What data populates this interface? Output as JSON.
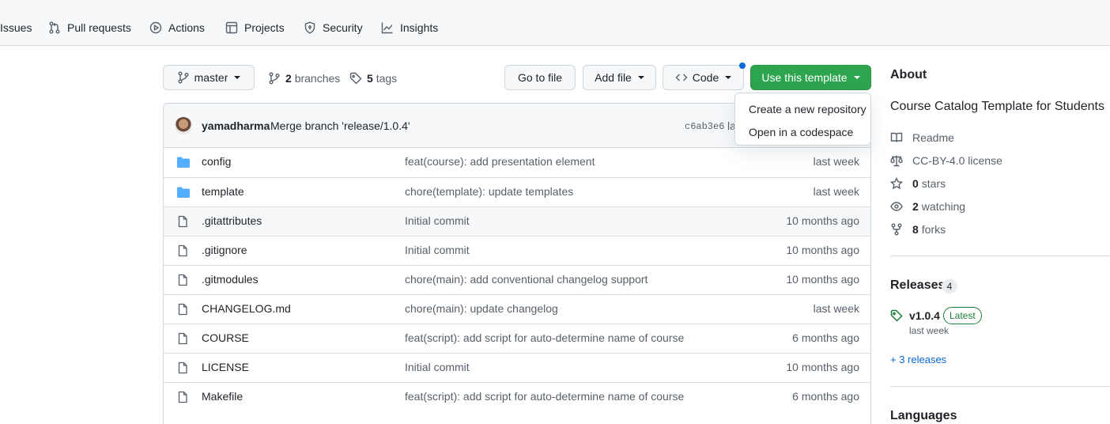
{
  "repo_nav": {
    "items": [
      {
        "label": "Issues",
        "icon": "issue-icon"
      },
      {
        "label": "Pull requests",
        "icon": "pull-request-icon"
      },
      {
        "label": "Actions",
        "icon": "play-icon"
      },
      {
        "label": "Projects",
        "icon": "table-icon"
      },
      {
        "label": "Security",
        "icon": "shield-icon"
      },
      {
        "label": "Insights",
        "icon": "graph-icon"
      }
    ]
  },
  "toolbar": {
    "branch": "master",
    "branches_count": "2",
    "branches_label": "branches",
    "tags_count": "5",
    "tags_label": "tags",
    "go_to_file": "Go to file",
    "add_file": "Add file",
    "code": "Code",
    "use_template": "Use this template"
  },
  "template_menu": {
    "items": [
      "Create a new repository",
      "Open in a codespace"
    ]
  },
  "latest_commit": {
    "author": "yamadharma",
    "message": "Merge branch 'release/1.0.4'",
    "sha": "c6ab3e6",
    "time_partial": "la"
  },
  "files": [
    {
      "type": "dir",
      "name": "config",
      "message": "feat(course): add presentation element",
      "time": "last week"
    },
    {
      "type": "dir",
      "name": "template",
      "message": "chore(template): update templates",
      "time": "last week"
    },
    {
      "type": "file",
      "name": ".gitattributes",
      "message": "Initial commit",
      "time": "10 months ago"
    },
    {
      "type": "file",
      "name": ".gitignore",
      "message": "Initial commit",
      "time": "10 months ago"
    },
    {
      "type": "file",
      "name": ".gitmodules",
      "message": "chore(main): add conventional changelog support",
      "time": "10 months ago"
    },
    {
      "type": "file",
      "name": "CHANGELOG.md",
      "message": "chore(main): update changelog",
      "time": "last week"
    },
    {
      "type": "file",
      "name": "COURSE",
      "message": "feat(script): add script for auto-determine name of course",
      "time": "6 months ago"
    },
    {
      "type": "file",
      "name": "LICENSE",
      "message": "Initial commit",
      "time": "10 months ago"
    },
    {
      "type": "file",
      "name": "Makefile",
      "message": "feat(script): add script for auto-determine name of course",
      "time": "6 months ago"
    }
  ],
  "about": {
    "title": "About",
    "description": "Course Catalog Template for Students",
    "readme": "Readme",
    "license": "CC-BY-4.0 license",
    "stars_count": "0",
    "stars_label": "stars",
    "watching_count": "2",
    "watching_label": "watching",
    "forks_count": "8",
    "forks_label": "forks"
  },
  "releases": {
    "title": "Releases",
    "count": "4",
    "latest_name": "v1.0.4",
    "latest_badge": "Latest",
    "latest_date": "last week",
    "more_link": "+ 3 releases"
  },
  "languages": {
    "title": "Languages"
  },
  "colors": {
    "primary_green": "#2da44e",
    "link_blue": "#0969da",
    "folder_blue": "#54aeff",
    "border": "#d0d7de"
  }
}
